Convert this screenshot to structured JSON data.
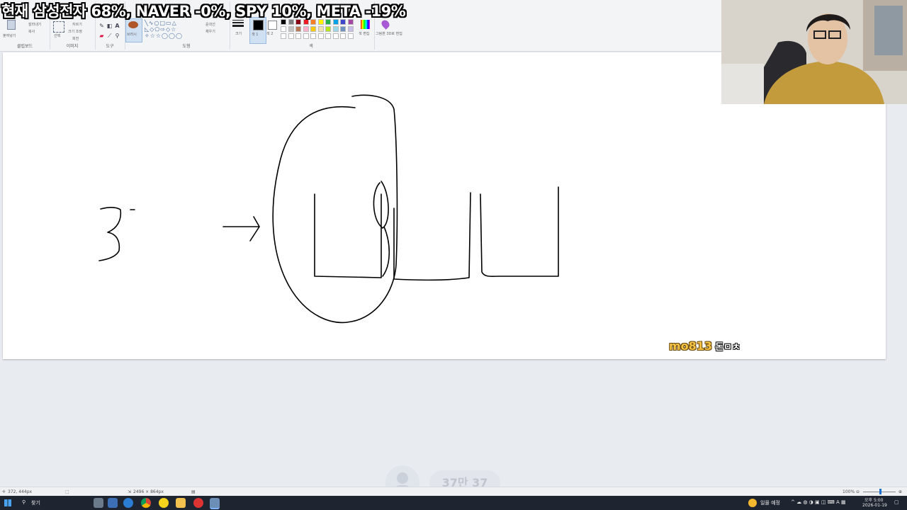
{
  "overlay": {
    "ticker_text": "현재 삼성전자 68%, NAVER -0%, SPY 10%, META -19%"
  },
  "ribbon": {
    "clipboard": {
      "paste_label": "붙여넣기",
      "cut_label": "잘라내기",
      "copy_label": "복사",
      "group_label": "클립보드"
    },
    "image": {
      "select_label": "선택",
      "crop_label": "자르기",
      "resize_label": "크기 조정",
      "rotate_label": "회전",
      "group_label": "이미지"
    },
    "tools": {
      "group_label": "도구"
    },
    "brushes": {
      "label": "브러시"
    },
    "shapes": {
      "outline_label": "윤곽선",
      "fill_label": "채우기",
      "group_label": "도형"
    },
    "size": {
      "label": "크기"
    },
    "colors": {
      "color1_label": "색 1",
      "color2_label": "색 2",
      "edit_label": "색 편집",
      "group_label": "색",
      "palette_row1": [
        "#000000",
        "#7f7f7f",
        "#880015",
        "#ed1c24",
        "#ff7f27",
        "#fff200",
        "#22b14c",
        "#00a2e8",
        "#3f48cc",
        "#a349a4"
      ],
      "palette_row2": [
        "#ffffff",
        "#c3c3c3",
        "#b97a57",
        "#ffaec9",
        "#ffc90e",
        "#efe4b0",
        "#b5e61d",
        "#99d9ea",
        "#7092be",
        "#c8bfe7"
      ]
    },
    "paint3d": {
      "label": "그림판 3D로 편집"
    }
  },
  "stream": {
    "donation_user": "mo813",
    "donation_message": "돈ㅁㅊ",
    "viewer_count": "37만 37"
  },
  "statusbar": {
    "cursor_position": "372, 444px",
    "canvas_size": "2496 × 864px",
    "zoom": "100%"
  },
  "taskbar": {
    "search_label": "찾기",
    "weather_label": "일몰 예정",
    "time": "오후 5:00",
    "date": "2026-01-19"
  }
}
